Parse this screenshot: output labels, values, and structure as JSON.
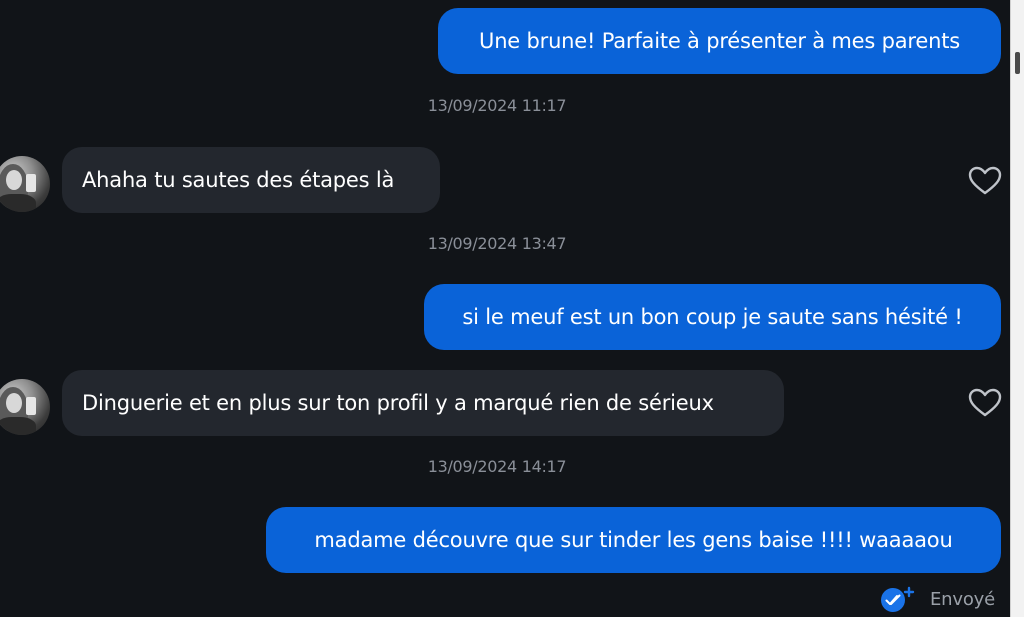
{
  "conversation": {
    "messages": [
      {
        "id": "m1",
        "direction": "sent",
        "text": "Une brune! Parfaite à présenter à mes parents"
      },
      {
        "id": "t1",
        "type": "timestamp",
        "text": "13/09/2024 11:17"
      },
      {
        "id": "m2",
        "direction": "received",
        "text": "Ahaha tu sautes des étapes là"
      },
      {
        "id": "t2",
        "type": "timestamp",
        "text": "13/09/2024 13:47"
      },
      {
        "id": "m3",
        "direction": "sent",
        "text": "si le meuf est un bon coup je saute sans hésité !"
      },
      {
        "id": "m4",
        "direction": "received",
        "text": "Dinguerie et en plus sur ton profil y a marqué rien de sérieux"
      },
      {
        "id": "t3",
        "type": "timestamp",
        "text": "13/09/2024 14:17"
      },
      {
        "id": "m5",
        "direction": "sent",
        "text": "madame découvre que sur tinder les gens baise !!!! waaaaou"
      }
    ],
    "status": {
      "label": "Envoyé",
      "icon": "double-check-icon"
    }
  },
  "icons": {
    "like": "heart-outline-icon",
    "avatar": "profile-photo"
  },
  "colors": {
    "background": "#111418",
    "sent_bubble": "#0a63d8",
    "received_bubble": "#23272e",
    "timestamp": "#8a8f98",
    "status_icon": "#1a73e8"
  }
}
